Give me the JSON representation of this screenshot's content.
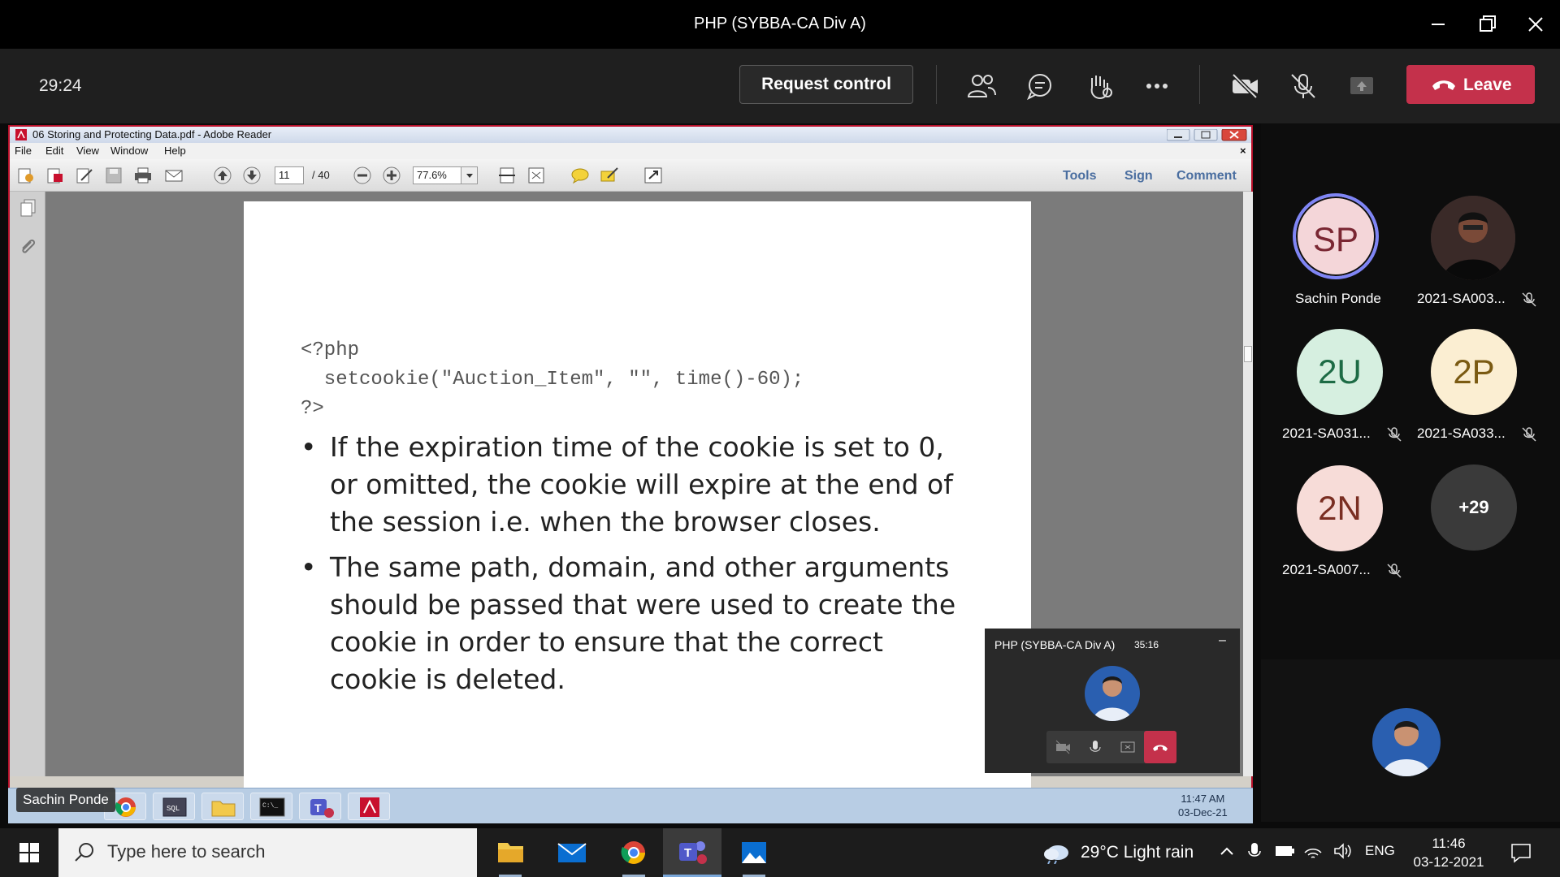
{
  "window": {
    "title": "PHP (SYBBA-CA Div A)"
  },
  "meeting": {
    "timer": "29:24",
    "request_control_label": "Request control",
    "leave_label": "Leave"
  },
  "reader": {
    "title": "06 Storing and Protecting Data.pdf - Adobe Reader",
    "menu": [
      "File",
      "Edit",
      "View",
      "Window",
      "Help"
    ],
    "page_current": "11",
    "page_total": "/ 40",
    "zoom": "77.6%",
    "links": [
      "Tools",
      "Sign",
      "Comment"
    ]
  },
  "slide": {
    "code_lines": [
      "<?php",
      "  setcookie(\"Auction_Item\", \"\", time()-60);",
      "?>"
    ],
    "bullets": [
      [
        "If the expiration time of the cookie is set to 0,",
        "or omitted, the cookie will expire at the end of",
        "the session i.e. when the browser closes."
      ],
      [
        "The same path, domain, and other arguments",
        "should be passed that were used to create the",
        "cookie in order to ensure that the correct",
        "cookie is deleted."
      ]
    ]
  },
  "remote_taskbar": {
    "sharer_name": "Sachin Ponde",
    "time": "11:47 AM",
    "date": "03-Dec-21"
  },
  "mini_call": {
    "title": "PHP (SYBBA-CA Div A)",
    "timer": "35:16"
  },
  "participants": [
    {
      "initials": "SP",
      "name": "Sachin Ponde",
      "muted": false,
      "bg": "#f4d6d9",
      "fg": "#7a2733"
    },
    {
      "initials": "",
      "name": "2021-SA003...",
      "muted": true,
      "bg": "#333333",
      "fg": "#ffffff"
    },
    {
      "initials": "2U",
      "name": "2021-SA031...",
      "muted": true,
      "bg": "#d6efe0",
      "fg": "#1d6b45"
    },
    {
      "initials": "2P",
      "name": "2021-SA033...",
      "muted": true,
      "bg": "#fbeed2",
      "fg": "#7a5a12"
    },
    {
      "initials": "2N",
      "name": "2021-SA007...",
      "muted": true,
      "bg": "#f7dcd8",
      "fg": "#7a2e22"
    },
    {
      "initials": "+29",
      "name": "",
      "muted": false,
      "bg": "#3a3a3a",
      "fg": "#ffffff"
    }
  ],
  "win_taskbar": {
    "search_placeholder": "Type here to search",
    "weather": "29°C  Light rain",
    "lang": "ENG",
    "time": "11:46",
    "date": "03-12-2021"
  },
  "colors": {
    "leave": "#c4314b",
    "accent": "#7f85f5"
  }
}
